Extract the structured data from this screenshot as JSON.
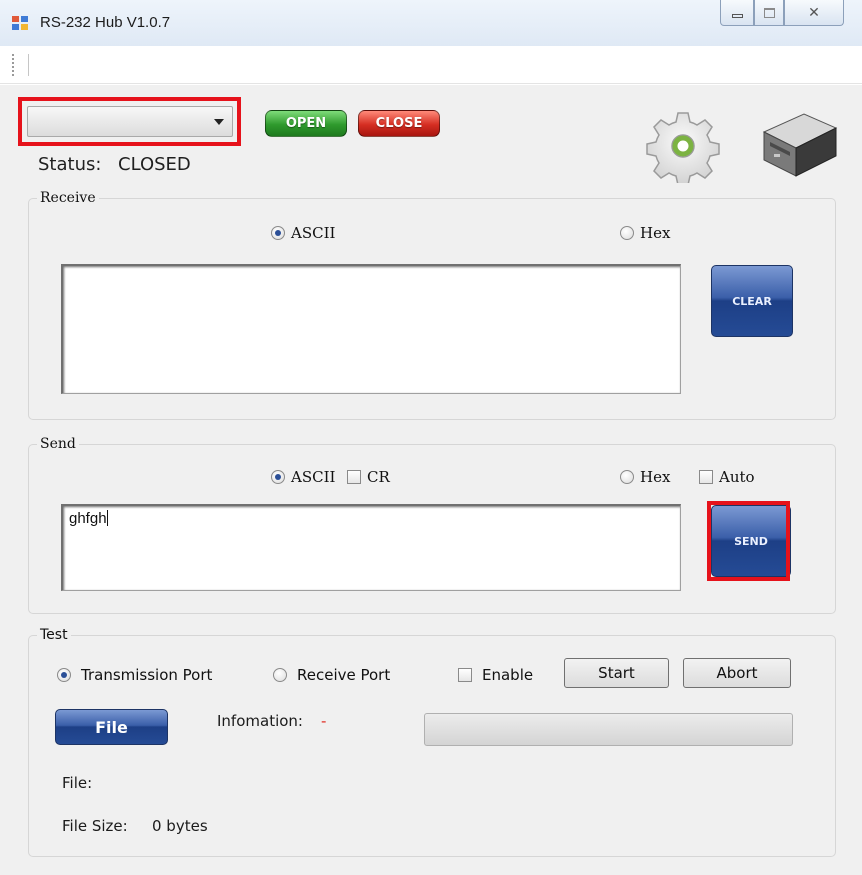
{
  "window": {
    "title": "RS-232 Hub V1.0.7",
    "close_glyph": "✕"
  },
  "connection": {
    "port_value": "",
    "open_label": "OPEN",
    "close_label": "CLOSE",
    "status_label": "Status:",
    "status_value": "CLOSED"
  },
  "icons": {
    "settings": "gear-icon",
    "device": "hard-drive-icon"
  },
  "receive": {
    "legend": "Receive",
    "ascii_label": "ASCII",
    "hex_label": "Hex",
    "selected_mode": "ASCII",
    "text": "",
    "clear_label": "CLEAR"
  },
  "send": {
    "legend": "Send",
    "ascii_label": "ASCII",
    "cr_label": "CR",
    "hex_label": "Hex",
    "auto_label": "Auto",
    "selected_mode": "ASCII",
    "text": "ghfgh",
    "send_label": "SEND"
  },
  "test": {
    "legend": "Test",
    "transmission_port_label": "Transmission Port",
    "receive_port_label": "Receive Port",
    "selected_port": "Transmission Port",
    "enable_label": "Enable",
    "start_label": "Start",
    "abort_label": "Abort",
    "file_button_label": "File",
    "information_label": "Infomation:",
    "information_value": "-",
    "progress": 0,
    "file_label": "File:",
    "file_value": "",
    "file_size_label": "File Size:",
    "file_size_value": "0 bytes"
  },
  "colors": {
    "highlight": "#e6121b",
    "open_green": "#2f9a2d",
    "close_red": "#d52e22",
    "button_blue": "#1d3f86",
    "info_dash": "#e0291f"
  }
}
